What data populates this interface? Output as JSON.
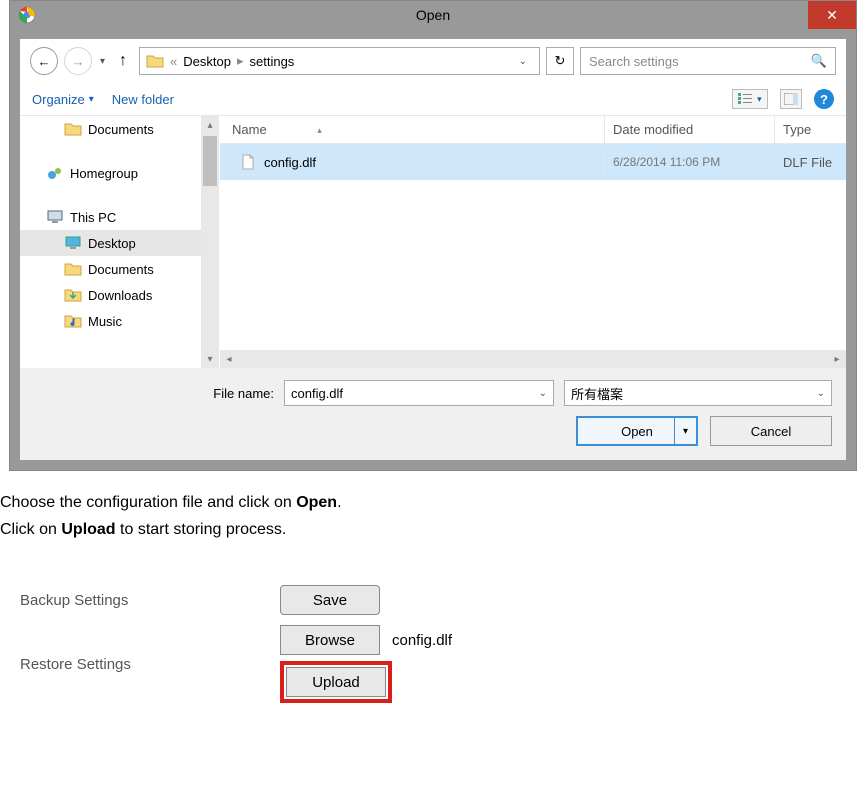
{
  "dialog": {
    "title": "Open",
    "breadcrumbs": {
      "sep1": "«",
      "root": "Desktop",
      "sep2": "▸",
      "folder": "settings"
    },
    "search_placeholder": "Search settings",
    "toolbar": {
      "organize": "Organize",
      "new_folder": "New folder"
    },
    "sidebar": {
      "documents": "Documents",
      "homegroup": "Homegroup",
      "this_pc": "This PC",
      "desktop": "Desktop",
      "documents2": "Documents",
      "downloads": "Downloads",
      "music": "Music"
    },
    "columns": {
      "name": "Name",
      "date": "Date modified",
      "type": "Type"
    },
    "file": {
      "name": "config.dlf",
      "date": "6/28/2014 11:06 PM",
      "type": "DLF File"
    },
    "filename_label": "File name:",
    "filename_value": "config.dlf",
    "filter_value": "所有檔案",
    "open_btn": "Open",
    "cancel_btn": "Cancel"
  },
  "instructions": {
    "line1a": "Choose the configuration file and click on ",
    "line1b": "Open",
    "line1c": ".",
    "line2a": "Click on ",
    "line2b": "Upload",
    "line2c": " to start storing process."
  },
  "settings": {
    "backup_label": "Backup Settings",
    "restore_label": "Restore Settings",
    "save_btn": "Save",
    "browse_btn": "Browse",
    "upload_btn": "Upload",
    "config_name": "config.dlf"
  }
}
